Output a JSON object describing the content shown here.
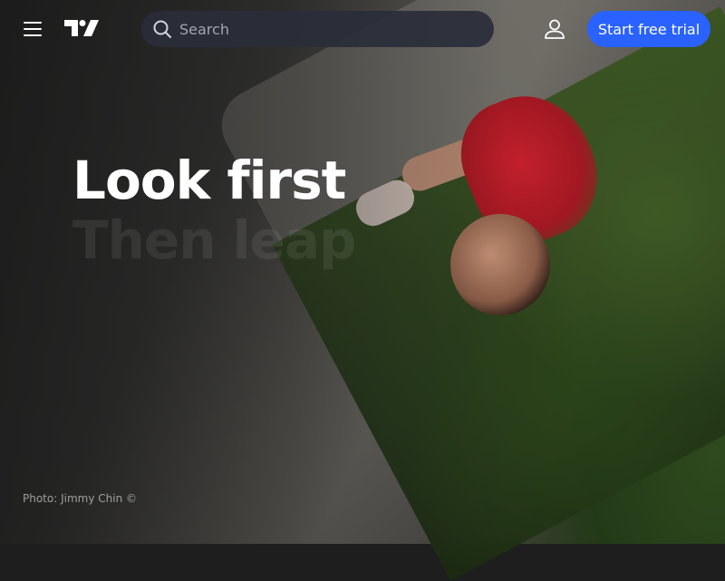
{
  "header": {
    "search": {
      "placeholder": "Search"
    },
    "trial_button": "Start free trial"
  },
  "hero": {
    "headline_line1": "Look first",
    "headline_line2": "Then leap",
    "photo_credit": "Photo: Jimmy Chin ©"
  },
  "colors": {
    "accent": "#2962ff",
    "search_bg": "#2a2e39",
    "text_primary": "#ffffff"
  },
  "icons": {
    "menu": "hamburger-menu-icon",
    "logo": "tradingview-logo",
    "search": "magnifier-icon",
    "user": "user-icon"
  }
}
